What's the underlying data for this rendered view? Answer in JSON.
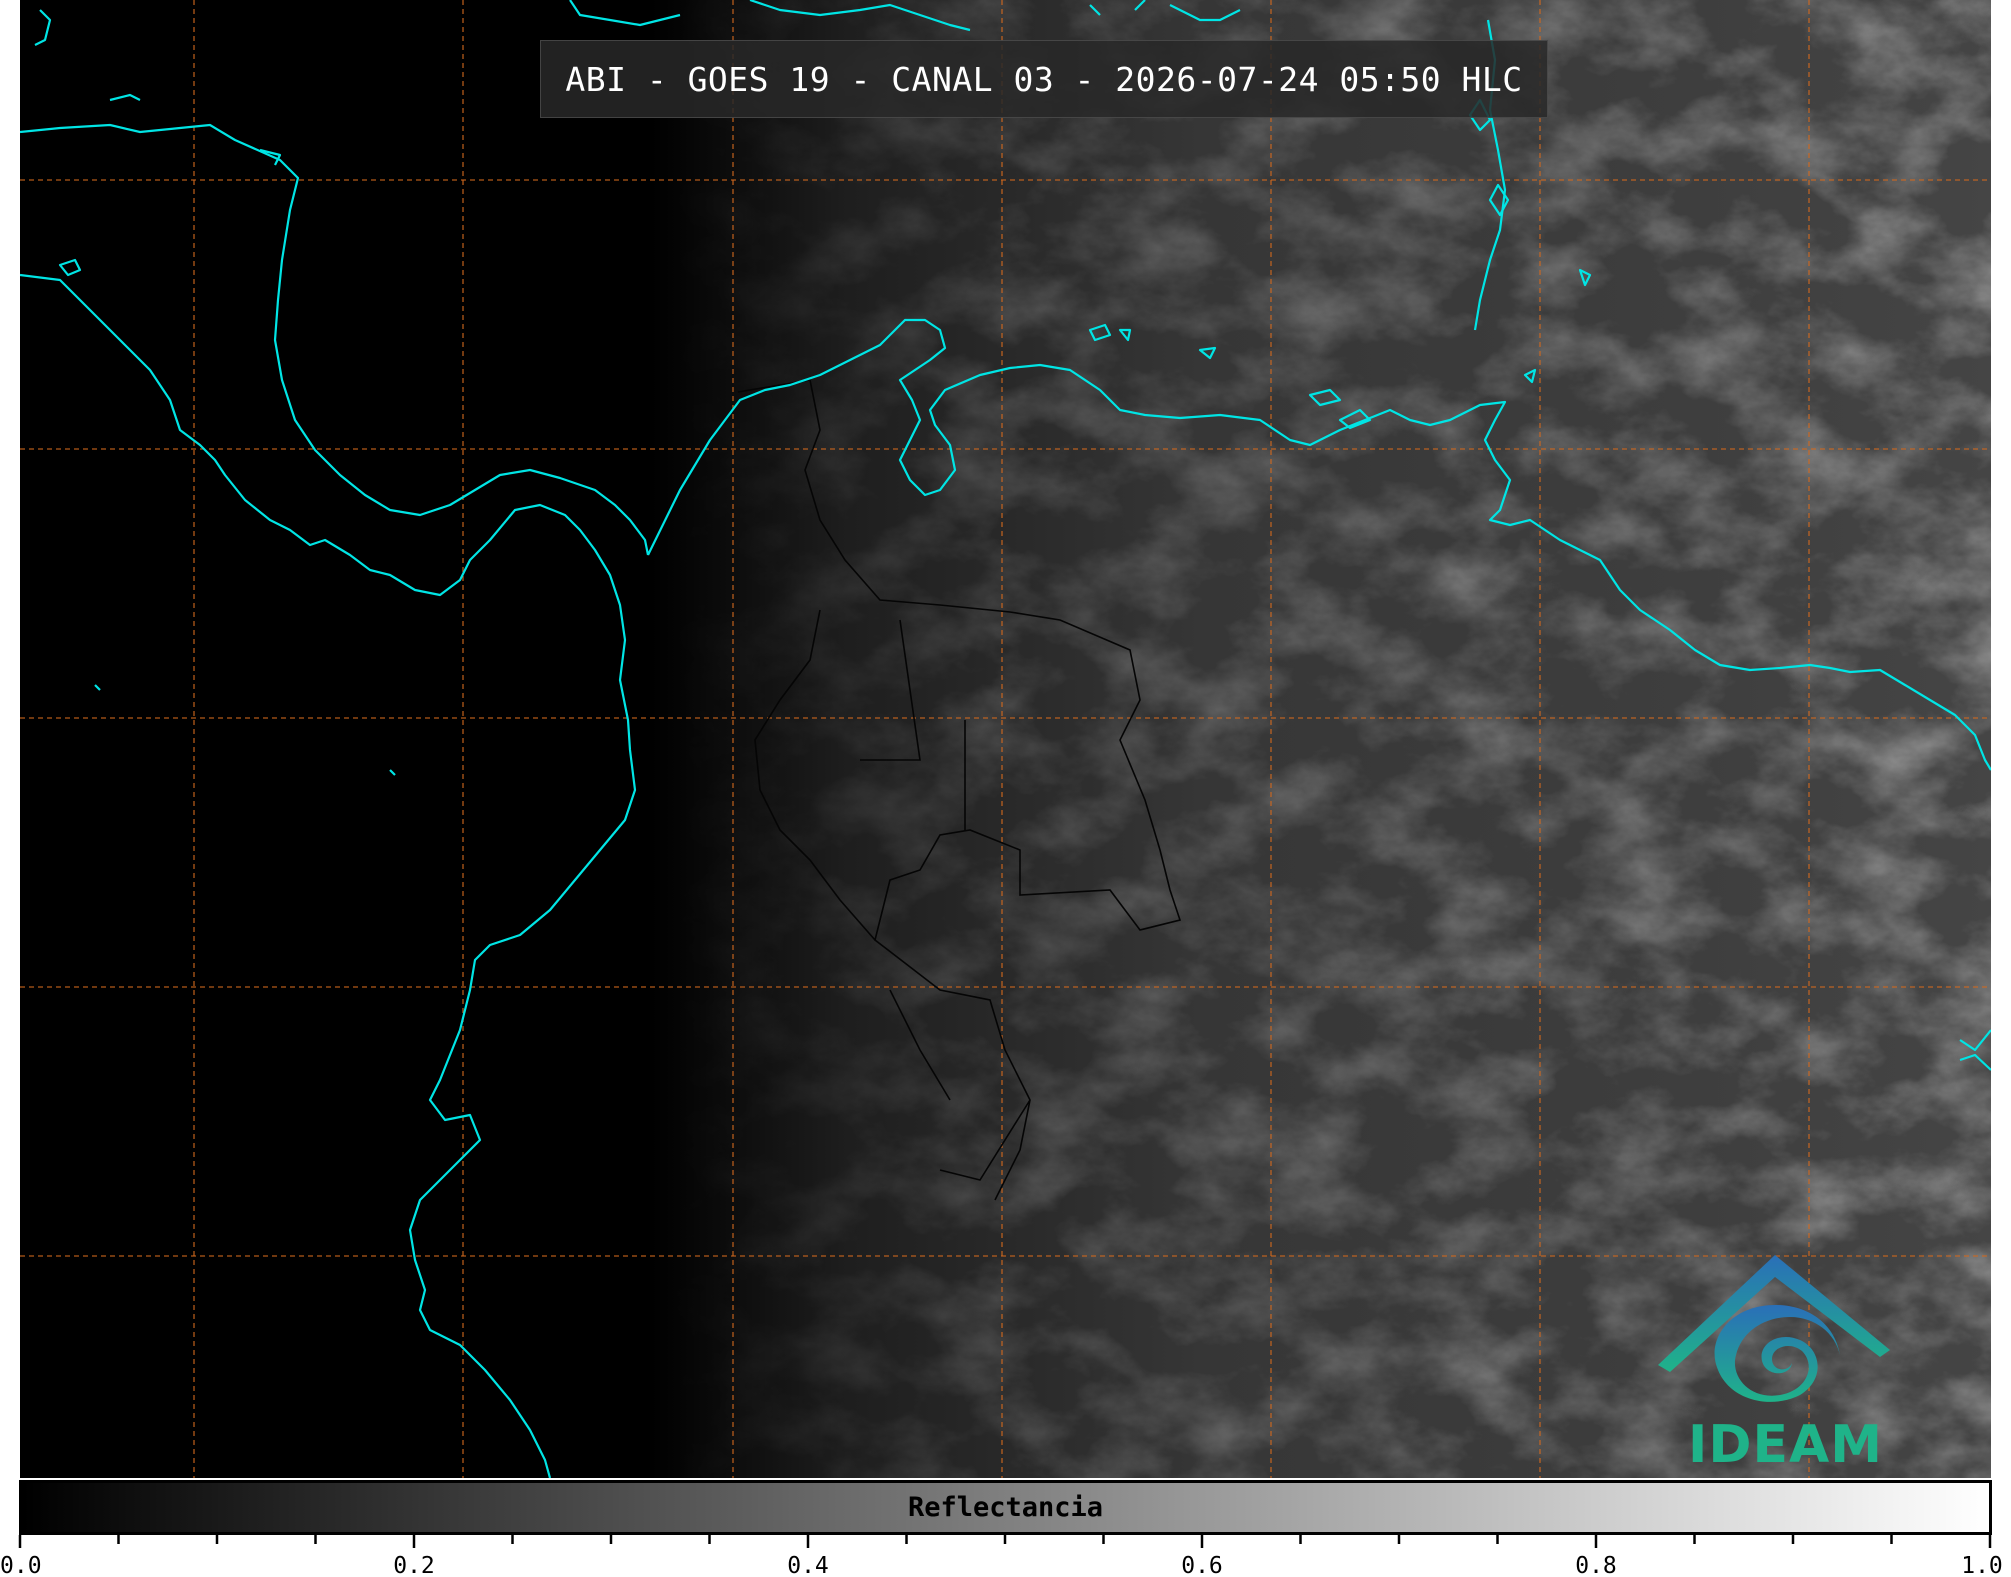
{
  "title": "ABI - GOES 19 - CANAL 03 - 2026-07-24 05:50 HLC",
  "colorbar": {
    "label": "Reflectancia",
    "min": 0.0,
    "max": 1.0,
    "major_ticks": [
      "0.0",
      "0.2",
      "0.4",
      "0.6",
      "0.8",
      "1.0"
    ],
    "minor_step": 0.05,
    "gradient_start": "#000000",
    "gradient_end": "#ffffff"
  },
  "logo": {
    "text": "IDEAM",
    "colors": {
      "top": "#2a6fb8",
      "bottom": "#1fb389"
    }
  },
  "colors": {
    "coastline": "#00e5e5",
    "gridline": "#d2691e",
    "borders": "#000000",
    "background": "#000000"
  },
  "icons": {
    "logo": "ideam-logo-icon"
  }
}
